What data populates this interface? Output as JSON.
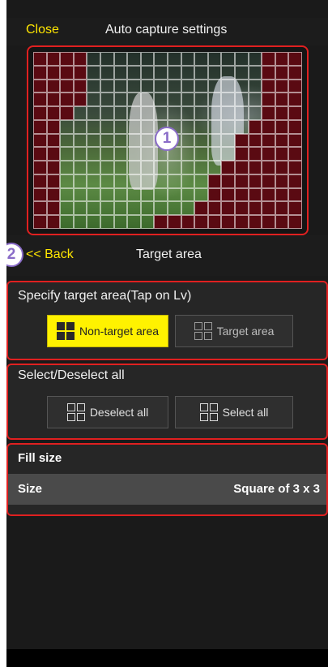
{
  "navbar": {
    "close_label": "Close",
    "title": "Auto capture settings"
  },
  "callouts": {
    "one": "1",
    "two": "2"
  },
  "back_row": {
    "back_label": "<< Back",
    "title": "Target area"
  },
  "target_panel": {
    "label": "Specify target area(Tap on Lv)",
    "non_target_label": "Non-target area",
    "target_label": "Target area",
    "selected": "Non-target area"
  },
  "select_panel": {
    "label": "Select/Deselect all",
    "deselect_label": "Deselect all",
    "select_label": "Select all"
  },
  "fill_panel": {
    "header": "Fill size",
    "size_label": "Size",
    "size_value": "Square of 3 x 3"
  },
  "grid": {
    "cols": 20,
    "rows": 13,
    "fill_color": "#5a0a12",
    "filled_rows": [
      "11110000000000000111",
      "11110000000000000111",
      "11110000000000000111",
      "11110000000000000111",
      "11100000000000000111",
      "11000000000000001111",
      "11000000000000011111",
      "11000000000000011111",
      "11000000000000111111",
      "11000000000001111111",
      "11000000000001111111",
      "11000000000011111111",
      "11000000011111111111"
    ]
  },
  "colors": {
    "accent": "#ffe600",
    "outline": "#e02020",
    "callout": "#8a6cc8"
  }
}
